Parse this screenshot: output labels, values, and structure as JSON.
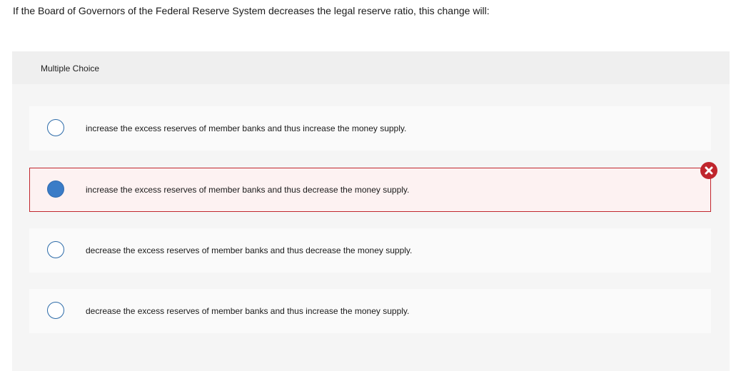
{
  "question": {
    "text": "If the Board of Governors of the Federal Reserve System decreases the legal reserve ratio, this change will:"
  },
  "panel": {
    "title": "Multiple Choice"
  },
  "options": [
    {
      "text": "increase the excess reserves of member banks and thus increase the money supply.",
      "selected": false,
      "state": ""
    },
    {
      "text": "increase the excess reserves of member banks and thus decrease the money supply.",
      "selected": true,
      "state": "incorrect"
    },
    {
      "text": "decrease the excess reserves of member banks and thus decrease the money supply.",
      "selected": false,
      "state": ""
    },
    {
      "text": "decrease the excess reserves of member banks and thus increase the money supply.",
      "selected": false,
      "state": ""
    }
  ],
  "feedback": {
    "icon": "incorrect-x-icon"
  },
  "colors": {
    "accent_blue": "#3a7cc7",
    "incorrect_red": "#c0262d",
    "incorrect_bg": "#fdf2f2",
    "panel_bg": "#f5f5f5",
    "option_bg": "#fafafa"
  }
}
